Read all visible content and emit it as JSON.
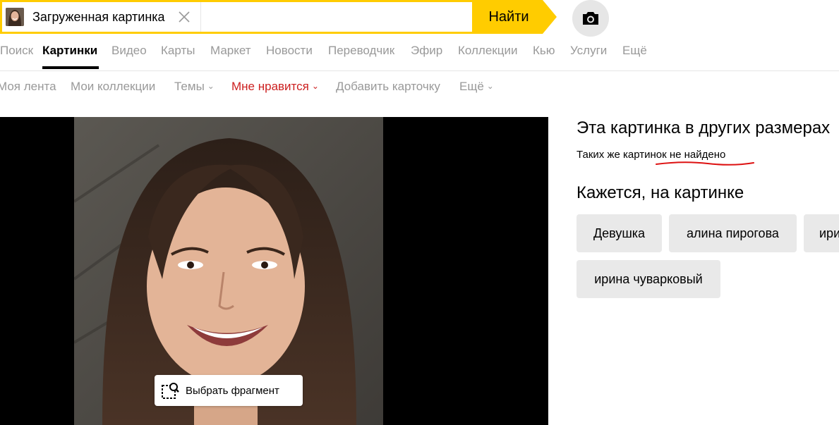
{
  "search": {
    "chip_label": "Загруженная картинка",
    "placeholder": "",
    "value": "",
    "find_label": "Найти"
  },
  "services": {
    "items": [
      "Поиск",
      "Картинки",
      "Видео",
      "Карты",
      "Маркет",
      "Новости",
      "Переводчик",
      "Эфир",
      "Коллекции",
      "Кью",
      "Услуги",
      "Ещё"
    ],
    "active_index": 1
  },
  "subnav": {
    "items": [
      "Моя лента",
      "Мои коллекции",
      "Темы",
      "Мне нравится",
      "Добавить карточку",
      "Ещё"
    ]
  },
  "viewer": {
    "select_fragment_label": "Выбрать фрагмент"
  },
  "panel": {
    "sizes_title": "Эта картинка в других размерах",
    "not_found_text": "Таких же картинок не найдено",
    "seems_title": "Кажется, на картинке",
    "tags": [
      "Девушка",
      "алина пирогова",
      "ири",
      "ирина чуварковый"
    ]
  },
  "colors": {
    "accent_yellow": "#ffcc00",
    "active_red": "#cc1f1f",
    "inactive_gray": "#999999",
    "tag_bg": "#e9e9e9"
  }
}
